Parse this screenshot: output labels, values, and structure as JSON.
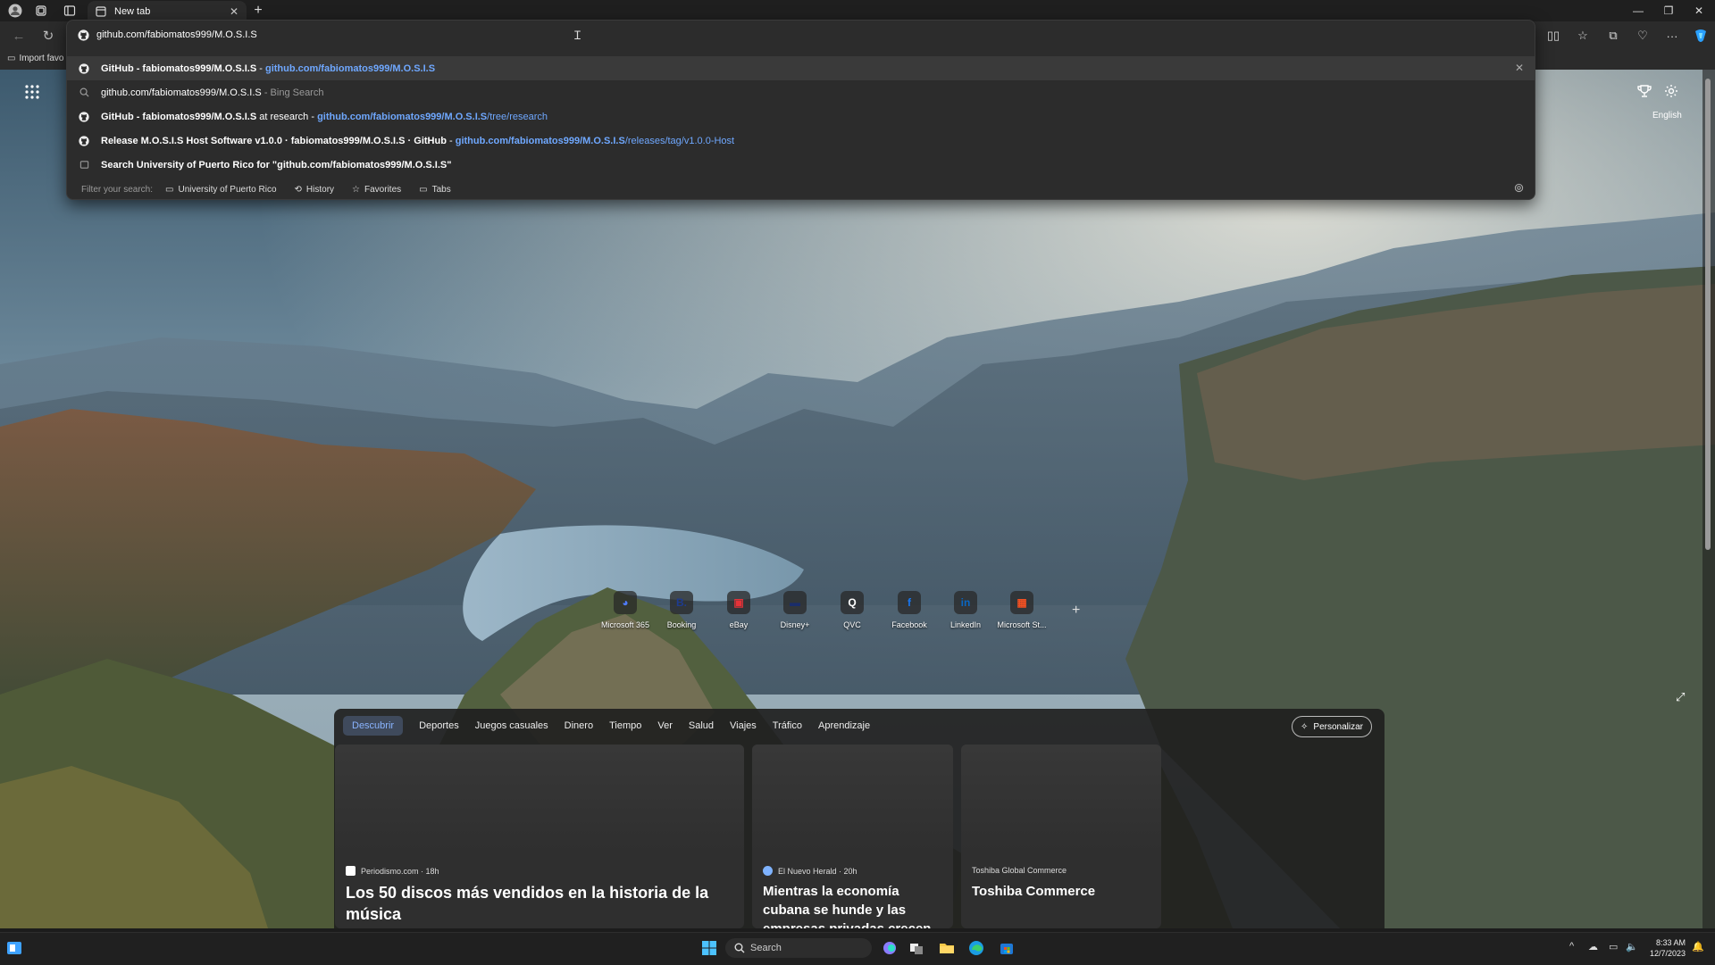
{
  "browser": {
    "tab_title": "New tab",
    "address_value": "github.com/fabiomatos999/M.O.S.I.S",
    "favorites_bar_label": "Import favo"
  },
  "suggestions": [
    {
      "a": "GitHub - fabiomatos999/M.O.S.I.S",
      "b": " - ",
      "url": "github.com/fabiomatos999/M.O.S.I.S",
      "url_rest": ""
    },
    {
      "a": "github.com/fabiomatos999/M.O.S.I.S",
      "b": " - Bing Search",
      "url": "",
      "url_rest": ""
    },
    {
      "a": "GitHub - fabiomatos999/M.O.S.I.S",
      "b": " at research - ",
      "url": "github.com/fabiomatos999/M.O.S.I.S",
      "url_rest": "/tree/research"
    },
    {
      "a": "Release M.O.S.I.S Host Software v1.0.0 · fabiomatos999/M.O.S.I.S · GitHub",
      "b": " - ",
      "url": "github.com/fabiomatos999/M.O.S.I.S",
      "url_rest": "/releases/tag/v1.0.0-Host"
    },
    {
      "a": "Search University of Puerto Rico for \"github.com/fabiomatos999/M.O.S.I.S\"",
      "b": "",
      "url": "",
      "url_rest": ""
    }
  ],
  "filter": {
    "label": "Filter your search:",
    "chips": [
      "University of Puerto Rico",
      "History",
      "Favorites",
      "Tabs"
    ]
  },
  "page": {
    "language": "English"
  },
  "quick_links": [
    {
      "label": "Microsoft 365",
      "glyph": "◕",
      "color": "#4f7cff"
    },
    {
      "label": "Booking",
      "glyph": "B.",
      "color": "#1e3b8f"
    },
    {
      "label": "eBay",
      "glyph": "▣",
      "color": "#e53238"
    },
    {
      "label": "Disney+",
      "glyph": "▬",
      "color": "#1a2d6b"
    },
    {
      "label": "QVC",
      "glyph": "Q",
      "color": "#ffffff"
    },
    {
      "label": "Facebook",
      "glyph": "f",
      "color": "#1877f2"
    },
    {
      "label": "LinkedIn",
      "glyph": "in",
      "color": "#0a66c2"
    },
    {
      "label": "Microsoft St...",
      "glyph": "▦",
      "color": "#f25022"
    }
  ],
  "feed": {
    "tabs": [
      "Descubrir",
      "Deportes",
      "Juegos casuales",
      "Dinero",
      "Tiempo",
      "Ver",
      "Salud",
      "Viajes",
      "Tráfico",
      "Aprendizaje"
    ],
    "personalize_label": "Personalizar",
    "cards": [
      {
        "source": "Periodismo.com · 18h",
        "title": "Los 50 discos más vendidos en la historia de la música"
      },
      {
        "source": "El Nuevo Herald · 20h",
        "title": "Mientras la economía cubana se hunde y las empresas privadas crecen, esto es lo..."
      },
      {
        "source": "Toshiba Global Commerce",
        "title": "Toshiba Commerce"
      }
    ]
  },
  "taskbar": {
    "search_placeholder": "Search",
    "time": "8:33 AM",
    "date": "12/7/2023"
  },
  "colors": {
    "accent_blue": "#6fa8ff",
    "selected_tab": "#8ab4ff"
  }
}
